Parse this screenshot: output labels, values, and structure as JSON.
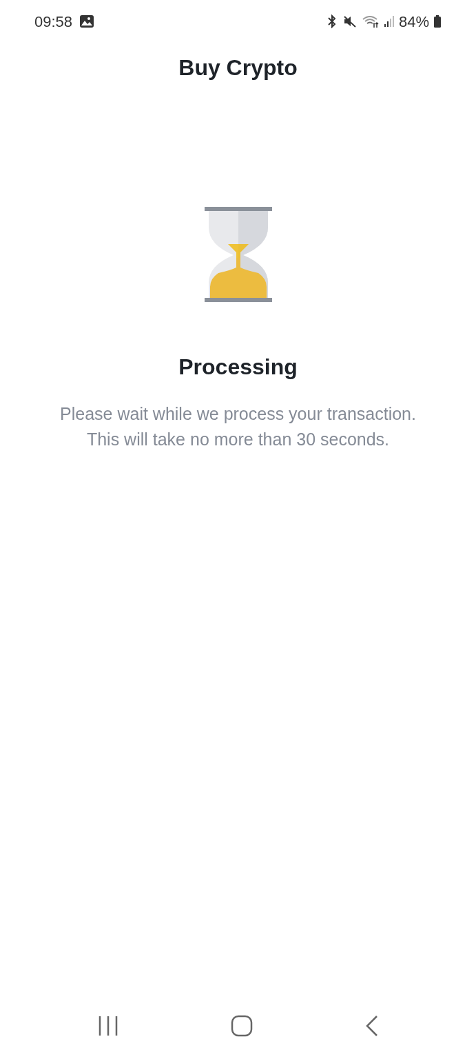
{
  "status_bar": {
    "time": "09:58",
    "battery": "84%"
  },
  "header": {
    "title": "Buy Crypto"
  },
  "status": {
    "title": "Processing",
    "message": "Please wait while we process your transaction. This will take no more than 30 seconds."
  }
}
